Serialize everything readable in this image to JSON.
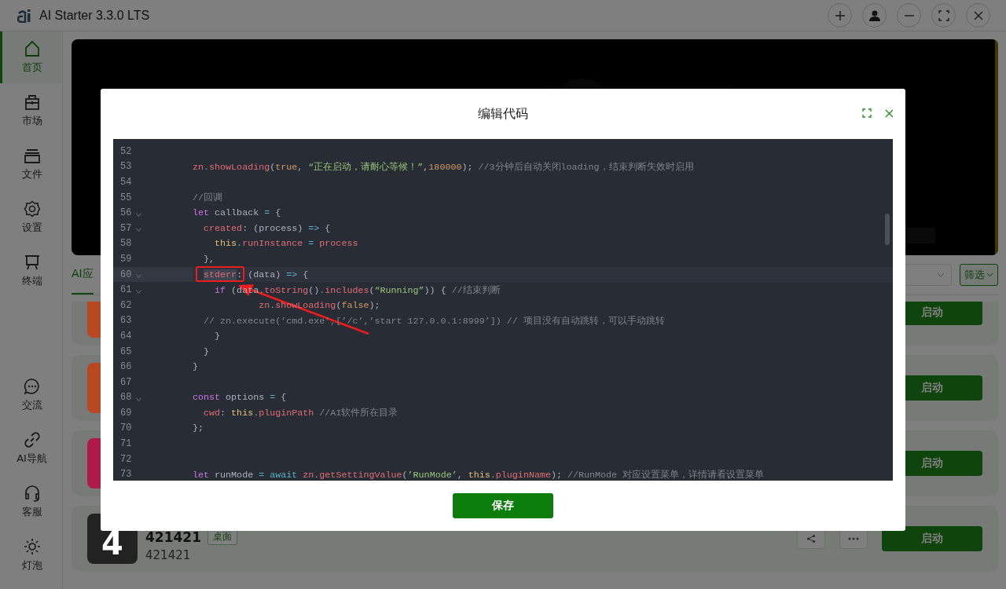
{
  "window": {
    "title": "AI Starter 3.3.0 LTS"
  },
  "sidebar": {
    "top": [
      {
        "label": "首页",
        "selected": true
      },
      {
        "label": "市场",
        "selected": false
      },
      {
        "label": "文件",
        "selected": false
      },
      {
        "label": "设置",
        "selected": false
      },
      {
        "label": "终端",
        "selected": false
      }
    ],
    "bottom": [
      {
        "label": "交流",
        "selected": false
      },
      {
        "label": "AI导航",
        "selected": false
      },
      {
        "label": "客服",
        "selected": false
      },
      {
        "label": "灯泡",
        "selected": false
      }
    ]
  },
  "tabs": [
    {
      "label": "AI应",
      "selected": true
    }
  ],
  "filter_button": "筛选",
  "apps": [
    {
      "color": "#b8481f",
      "button": "启动"
    },
    {
      "color": "#b8481f",
      "button": "启动"
    },
    {
      "color": "#b01a48",
      "button": "启动"
    },
    {
      "color": "#222222",
      "icon_text": "4",
      "title": "421421",
      "tag": "桌面",
      "subtitle": "421421",
      "button": "启动"
    }
  ],
  "dialog": {
    "title": "编辑代码",
    "save_button": "保存",
    "lines": [
      {
        "num": "52",
        "fold": false,
        "current": false
      },
      {
        "num": "53",
        "fold": false,
        "current": false,
        "tokens": [
          {
            "kind": "id",
            "text": "zn"
          },
          {
            "kind": "op",
            "text": "."
          },
          {
            "kind": "id",
            "text": "showLoading"
          },
          {
            "kind": "plain",
            "text": "("
          },
          {
            "kind": "num",
            "text": "true"
          },
          {
            "kind": "plain",
            "text": ", "
          },
          {
            "kind": "str",
            "text": "“正在启动，请耐心等候！”"
          },
          {
            "kind": "plain",
            "text": ","
          },
          {
            "kind": "num",
            "text": "180000"
          },
          {
            "kind": "plain",
            "text": "); "
          },
          {
            "kind": "comment",
            "text": "//3分钟后自动关闭loading，结束判断失效时启用"
          }
        ]
      },
      {
        "num": "54",
        "fold": false,
        "current": false
      },
      {
        "num": "55",
        "fold": false,
        "current": false,
        "tokens": [
          {
            "kind": "comment",
            "text": "//回调"
          }
        ]
      },
      {
        "num": "56",
        "fold": true,
        "current": false,
        "tokens": [
          {
            "kind": "kw",
            "text": "let"
          },
          {
            "kind": "plain",
            "text": " callback "
          },
          {
            "kind": "op",
            "text": "="
          },
          {
            "kind": "plain",
            "text": " {"
          }
        ]
      },
      {
        "num": "57",
        "fold": true,
        "current": false,
        "tokens": [
          {
            "kind": "id",
            "text": "  created"
          },
          {
            "kind": "plain",
            "text": ": (process) "
          },
          {
            "kind": "op",
            "text": "=>"
          },
          {
            "kind": "plain",
            "text": " {"
          }
        ]
      },
      {
        "num": "58",
        "fold": false,
        "current": false,
        "tokens": [
          {
            "kind": "this",
            "text": "    this"
          },
          {
            "kind": "op",
            "text": "."
          },
          {
            "kind": "id",
            "text": "runInstance"
          },
          {
            "kind": "op",
            "text": " = "
          },
          {
            "kind": "id",
            "text": "process"
          }
        ]
      },
      {
        "num": "59",
        "fold": false,
        "current": false,
        "tokens": [
          {
            "kind": "plain",
            "text": "  },"
          }
        ]
      },
      {
        "num": "60",
        "fold": true,
        "current": true,
        "tokens": [
          {
            "kind": "selected",
            "text": "  stderr"
          },
          {
            "kind": "plain",
            "text": ": (data) "
          },
          {
            "kind": "op",
            "text": "=>"
          },
          {
            "kind": "plain",
            "text": " {"
          }
        ]
      },
      {
        "num": "61",
        "fold": true,
        "current": false,
        "tokens": [
          {
            "kind": "kw",
            "text": "    if"
          },
          {
            "kind": "plain",
            "text": " (data"
          },
          {
            "kind": "op",
            "text": "."
          },
          {
            "kind": "id",
            "text": "toString"
          },
          {
            "kind": "plain",
            "text": "()"
          },
          {
            "kind": "op",
            "text": "."
          },
          {
            "kind": "id",
            "text": "includes"
          },
          {
            "kind": "plain",
            "text": "("
          },
          {
            "kind": "str",
            "text": "“Running”"
          },
          {
            "kind": "plain",
            "text": ")) { "
          },
          {
            "kind": "comment",
            "text": "//结束判断"
          }
        ]
      },
      {
        "num": "62",
        "fold": false,
        "current": false,
        "tokens": [
          {
            "kind": "id",
            "text": "            zn"
          },
          {
            "kind": "op",
            "text": "."
          },
          {
            "kind": "id",
            "text": "showLoading"
          },
          {
            "kind": "plain",
            "text": "("
          },
          {
            "kind": "num",
            "text": "false"
          },
          {
            "kind": "plain",
            "text": ");"
          }
        ]
      },
      {
        "num": "63",
        "fold": false,
        "current": false,
        "tokens": [
          {
            "kind": "comment",
            "text": "  // zn.execute(’cmd.exe’,[’/c’,’start 127.0.0.1:8999’]) // 项目没有自动跳转，可以手动跳转"
          }
        ]
      },
      {
        "num": "64",
        "fold": false,
        "current": false,
        "tokens": [
          {
            "kind": "plain",
            "text": "    }"
          }
        ]
      },
      {
        "num": "65",
        "fold": false,
        "current": false,
        "tokens": [
          {
            "kind": "plain",
            "text": "  }"
          }
        ]
      },
      {
        "num": "66",
        "fold": false,
        "current": false,
        "tokens": [
          {
            "kind": "plain",
            "text": "}"
          }
        ]
      },
      {
        "num": "67",
        "fold": false,
        "current": false
      },
      {
        "num": "68",
        "fold": true,
        "current": false,
        "tokens": [
          {
            "kind": "kw",
            "text": "const"
          },
          {
            "kind": "plain",
            "text": " options "
          },
          {
            "kind": "op",
            "text": "="
          },
          {
            "kind": "plain",
            "text": " {"
          }
        ]
      },
      {
        "num": "69",
        "fold": false,
        "current": false,
        "tokens": [
          {
            "kind": "id",
            "text": "  cwd"
          },
          {
            "kind": "plain",
            "text": ": "
          },
          {
            "kind": "this",
            "text": "this"
          },
          {
            "kind": "op",
            "text": "."
          },
          {
            "kind": "id",
            "text": "pluginPath"
          },
          {
            "kind": "comment",
            "text": " //AI软件所在目录"
          }
        ]
      },
      {
        "num": "70",
        "fold": false,
        "current": false,
        "tokens": [
          {
            "kind": "plain",
            "text": "};"
          }
        ]
      },
      {
        "num": "71",
        "fold": false,
        "current": false
      },
      {
        "num": "72",
        "fold": false,
        "current": false
      },
      {
        "num": "73",
        "fold": false,
        "current": false,
        "tokens": [
          {
            "kind": "kw",
            "text": "let"
          },
          {
            "kind": "plain",
            "text": " runMode "
          },
          {
            "kind": "op",
            "text": "= await"
          },
          {
            "kind": "id",
            "text": " zn"
          },
          {
            "kind": "op",
            "text": "."
          },
          {
            "kind": "id",
            "text": "getSettingValue"
          },
          {
            "kind": "plain",
            "text": "("
          },
          {
            "kind": "str",
            "text": "’RunMode’"
          },
          {
            "kind": "plain",
            "text": ", "
          },
          {
            "kind": "this",
            "text": "this"
          },
          {
            "kind": "op",
            "text": "."
          },
          {
            "kind": "id",
            "text": "pluginName"
          },
          {
            "kind": "plain",
            "text": "); "
          },
          {
            "kind": "comment",
            "text": "//RunMode 对应设置菜单，详情请看设置菜单"
          }
        ]
      }
    ]
  }
}
